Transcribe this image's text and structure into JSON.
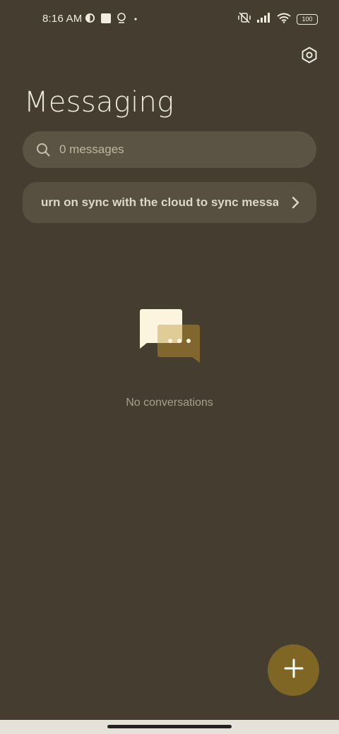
{
  "status_bar": {
    "time": "8:16 AM",
    "battery": "100"
  },
  "header": {
    "title": "Messaging"
  },
  "search": {
    "placeholder": "0 messages"
  },
  "sync_banner": {
    "text": "urn on sync with the cloud to sync messag"
  },
  "empty_state": {
    "text": "No conversations"
  },
  "colors": {
    "background": "#453e30",
    "fab": "#7f6624",
    "search_bg": "#5b5445"
  }
}
